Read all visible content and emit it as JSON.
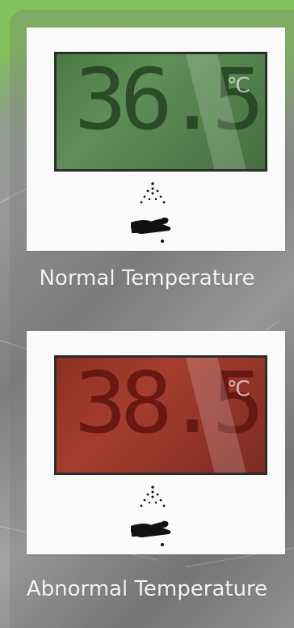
{
  "background": {
    "accent_green": "#82C45A",
    "panel_gray": "#8C8C8C"
  },
  "cards": [
    {
      "display_value": "36.5",
      "unit": "℃",
      "caption": "Normal Temperature",
      "screen_color": "#5D8F57",
      "icons": [
        "spray-icon",
        "hand-icon"
      ]
    },
    {
      "display_value": "38.5",
      "unit": "℃",
      "caption": "Abnormal Temperature",
      "screen_color": "#A53D2F",
      "icons": [
        "spray-icon",
        "hand-icon"
      ]
    }
  ]
}
